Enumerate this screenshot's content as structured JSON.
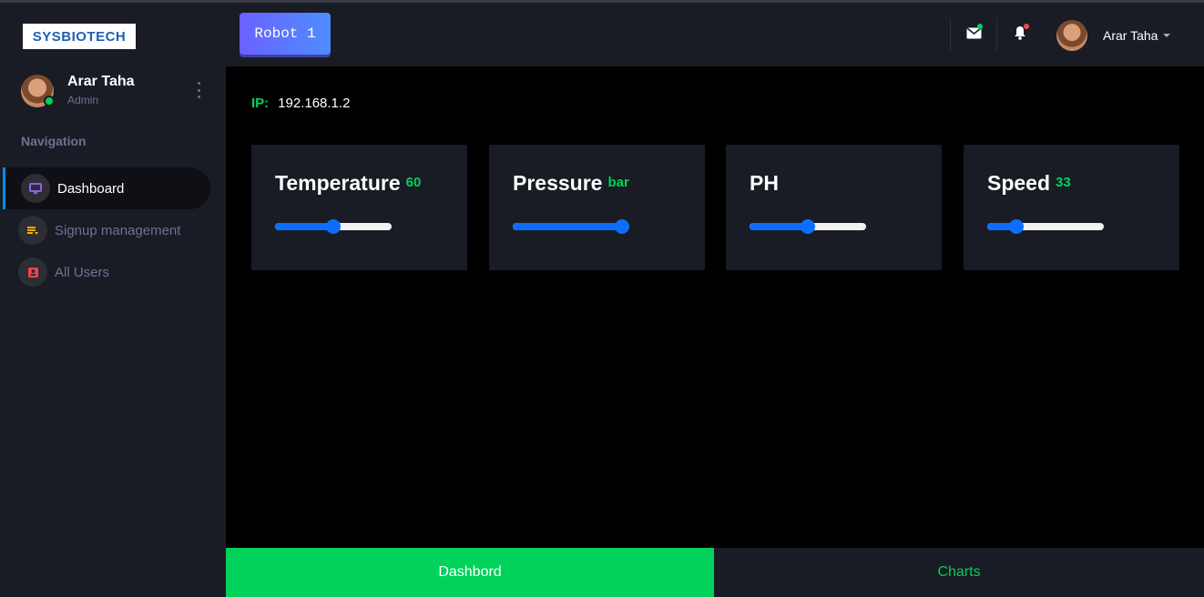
{
  "brand": {
    "logo_text": "SYSBIOTECH"
  },
  "sidebar": {
    "profile": {
      "name": "Arar Taha",
      "role": "Admin"
    },
    "nav_label": "Navigation",
    "items": [
      {
        "label": "Dashboard",
        "icon": "monitor-icon",
        "color": "#8f5fe8",
        "active": true
      },
      {
        "label": "Signup management",
        "icon": "list-icon",
        "color": "#ffab00",
        "active": false
      },
      {
        "label": "All Users",
        "icon": "contact-card-icon",
        "color": "#fc424a",
        "active": false
      }
    ]
  },
  "topbar": {
    "robot_button": "Robot 1",
    "mail_badge_color": "#00d25b",
    "bell_badge_color": "#fc424a",
    "user_name": "Arar Taha"
  },
  "ip": {
    "label": "IP:",
    "value": "192.168.1.2"
  },
  "cards": [
    {
      "title": "Temperature",
      "value": "60",
      "slider_fraction": 0.5
    },
    {
      "title": "Pressure",
      "value": "bar",
      "slider_fraction": 1.0
    },
    {
      "title": "PH",
      "value": "",
      "slider_fraction": 0.5
    },
    {
      "title": "Speed",
      "value": "33",
      "slider_fraction": 0.25
    }
  ],
  "bottom_tabs": {
    "dashboard": "Dashbord",
    "charts": "Charts"
  },
  "colors": {
    "accent_green": "#00d25b",
    "slider_blue": "#0d6efd",
    "panel": "#191c24"
  }
}
